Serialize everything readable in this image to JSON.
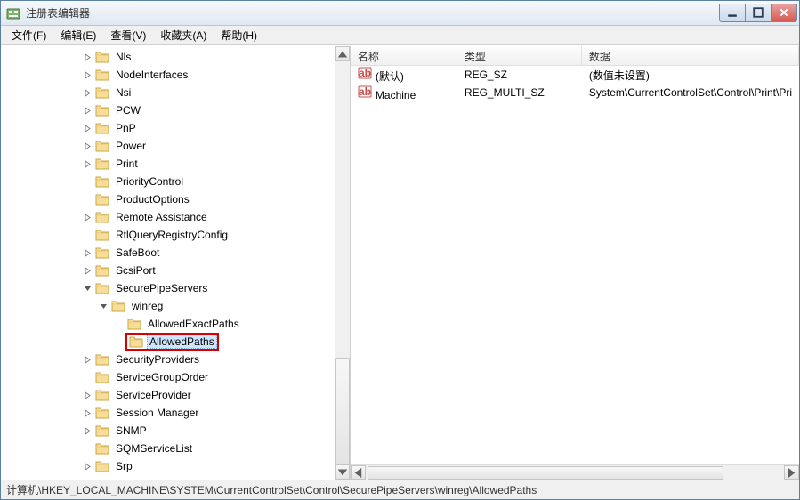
{
  "window": {
    "title": "注册表编辑器"
  },
  "menu": {
    "file": "文件(F)",
    "edit": "编辑(E)",
    "view": "查看(V)",
    "favorites": "收藏夹(A)",
    "help": "帮助(H)"
  },
  "tree": {
    "items": [
      {
        "indent": 5,
        "expander": "closed",
        "label": "Nls"
      },
      {
        "indent": 5,
        "expander": "closed",
        "label": "NodeInterfaces"
      },
      {
        "indent": 5,
        "expander": "closed",
        "label": "Nsi"
      },
      {
        "indent": 5,
        "expander": "closed",
        "label": "PCW"
      },
      {
        "indent": 5,
        "expander": "closed",
        "label": "PnP"
      },
      {
        "indent": 5,
        "expander": "closed",
        "label": "Power"
      },
      {
        "indent": 5,
        "expander": "closed",
        "label": "Print"
      },
      {
        "indent": 5,
        "expander": "none",
        "label": "PriorityControl"
      },
      {
        "indent": 5,
        "expander": "none",
        "label": "ProductOptions"
      },
      {
        "indent": 5,
        "expander": "closed",
        "label": "Remote Assistance"
      },
      {
        "indent": 5,
        "expander": "none",
        "label": "RtlQueryRegistryConfig"
      },
      {
        "indent": 5,
        "expander": "closed",
        "label": "SafeBoot"
      },
      {
        "indent": 5,
        "expander": "closed",
        "label": "ScsiPort"
      },
      {
        "indent": 5,
        "expander": "open",
        "label": "SecurePipeServers"
      },
      {
        "indent": 6,
        "expander": "open",
        "label": "winreg"
      },
      {
        "indent": 7,
        "expander": "none",
        "label": "AllowedExactPaths"
      },
      {
        "indent": 7,
        "expander": "none",
        "label": "AllowedPaths",
        "selected": true,
        "highlighted": true
      },
      {
        "indent": 5,
        "expander": "closed",
        "label": "SecurityProviders"
      },
      {
        "indent": 5,
        "expander": "none",
        "label": "ServiceGroupOrder"
      },
      {
        "indent": 5,
        "expander": "closed",
        "label": "ServiceProvider"
      },
      {
        "indent": 5,
        "expander": "closed",
        "label": "Session Manager"
      },
      {
        "indent": 5,
        "expander": "closed",
        "label": "SNMP"
      },
      {
        "indent": 5,
        "expander": "none",
        "label": "SQMServiceList"
      },
      {
        "indent": 5,
        "expander": "closed",
        "label": "Srp"
      }
    ]
  },
  "list": {
    "columns": {
      "name": "名称",
      "type": "类型",
      "data": "数据"
    },
    "rows": [
      {
        "name": "(默认)",
        "type": "REG_SZ",
        "data": "(数值未设置)"
      },
      {
        "name": "Machine",
        "type": "REG_MULTI_SZ",
        "data": "System\\CurrentControlSet\\Control\\Print\\Pri"
      }
    ]
  },
  "statusbar": {
    "path": "计算机\\HKEY_LOCAL_MACHINE\\SYSTEM\\CurrentControlSet\\Control\\SecurePipeServers\\winreg\\AllowedPaths"
  }
}
